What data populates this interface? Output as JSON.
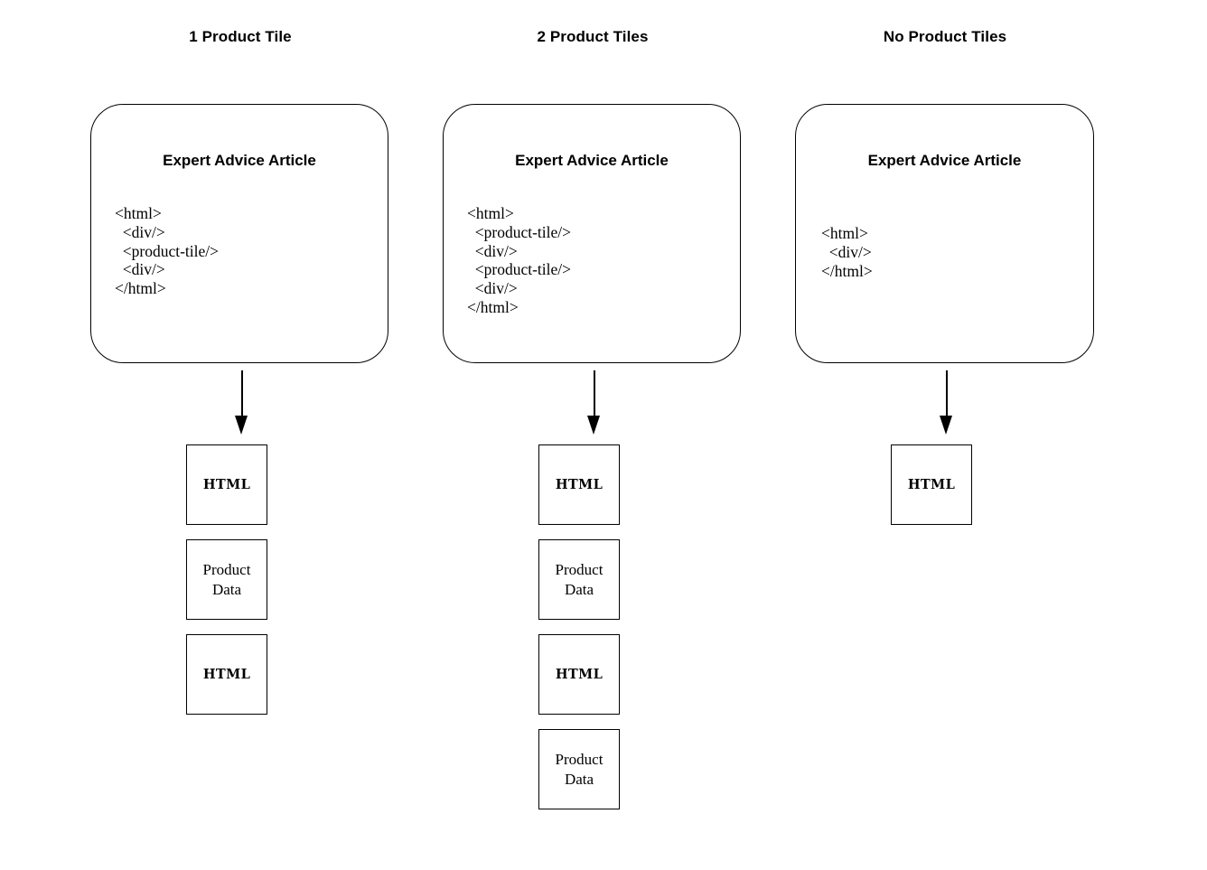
{
  "columns": [
    {
      "heading": "1 Product Tile",
      "card": {
        "title": "Expert Advice Article",
        "code": "<html>\n  <div/>\n  <product-tile/>\n  <div/>\n</html>"
      },
      "arrow": "down-arrow",
      "outputs": [
        {
          "kind": "html",
          "label": "HTML"
        },
        {
          "kind": "data",
          "label": "Product\nData"
        },
        {
          "kind": "html",
          "label": "HTML"
        }
      ]
    },
    {
      "heading": "2 Product Tiles",
      "card": {
        "title": "Expert Advice Article",
        "code": "<html>\n  <product-tile/>\n  <div/>\n  <product-tile/>\n  <div/>\n</html>"
      },
      "arrow": "down-arrow",
      "outputs": [
        {
          "kind": "html",
          "label": "HTML"
        },
        {
          "kind": "data",
          "label": "Product\nData"
        },
        {
          "kind": "html",
          "label": "HTML"
        },
        {
          "kind": "data",
          "label": "Product\nData"
        }
      ]
    },
    {
      "heading": "No Product Tiles",
      "card": {
        "title": "Expert Advice Article",
        "code": "<html>\n  <div/>\n</html>"
      },
      "arrow": "down-arrow",
      "outputs": [
        {
          "kind": "html",
          "label": "HTML"
        }
      ]
    }
  ],
  "colors": {
    "stroke": "#000000",
    "background": "#ffffff",
    "text": "#000000"
  }
}
